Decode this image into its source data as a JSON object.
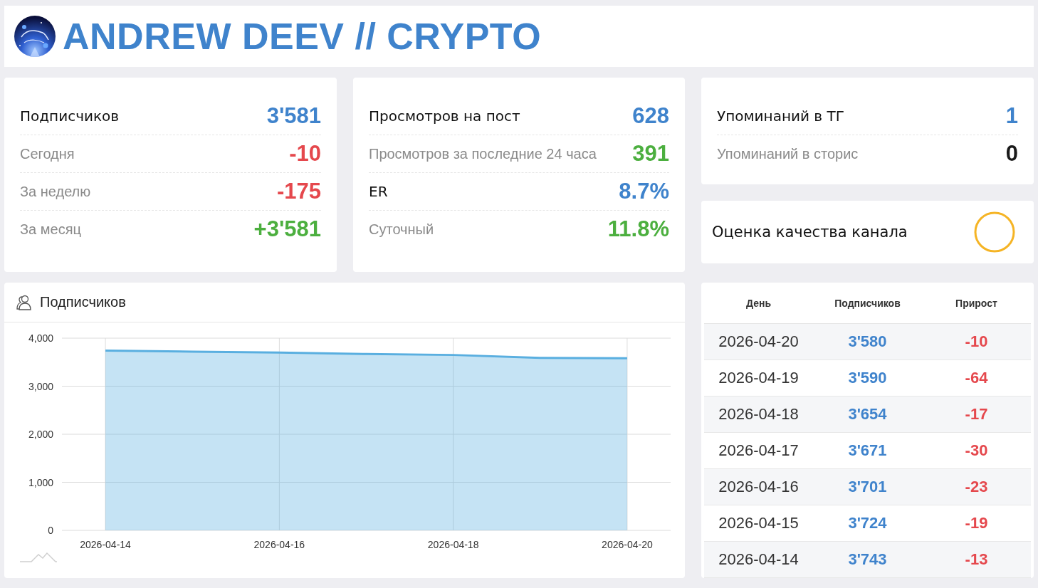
{
  "header": {
    "title": "ANDREW DEEV // CRYPTO"
  },
  "stat_cards": [
    {
      "rows": [
        {
          "kind": "heading",
          "label": "Подписчиков",
          "value": "3'581",
          "color": "#3f83cc"
        },
        {
          "kind": "detail",
          "label": "Сегодня",
          "value": "-10",
          "color": "#e5484d"
        },
        {
          "kind": "detail",
          "label": "За неделю",
          "value": "-175",
          "color": "#e5484d"
        },
        {
          "kind": "detail",
          "label": "За месяц",
          "value": "+3'581",
          "color": "#4caf3f"
        }
      ]
    },
    {
      "rows": [
        {
          "kind": "heading",
          "label": "Просмотров на пост",
          "value": "628",
          "color": "#3f83cc"
        },
        {
          "kind": "detail",
          "label": "Просмотров за последние 24 часа",
          "value": "391",
          "color": "#4caf3f"
        },
        {
          "kind": "heading",
          "label": "ER",
          "value": "8.7%",
          "color": "#3f83cc"
        },
        {
          "kind": "detail",
          "label": "Суточный",
          "value": "11.8%",
          "color": "#4caf3f"
        }
      ]
    }
  ],
  "mentions_card": {
    "rows": [
      {
        "kind": "heading",
        "label": "Упоминаний в ТГ",
        "value": "1",
        "color": "#3f83cc"
      },
      {
        "kind": "detail",
        "label": "Упоминаний в сторис",
        "value": "0",
        "color": "#1a1a1a"
      }
    ]
  },
  "quality_card": {
    "label": "Оценка качества канала"
  },
  "chart_panel": {
    "chart_data": {
      "type": "area",
      "title": "Подписчиков",
      "x": [
        "2026-04-14",
        "2026-04-15",
        "2026-04-16",
        "2026-04-17",
        "2026-04-18",
        "2026-04-19",
        "2026-04-20"
      ],
      "series": [
        {
          "color": "#5aafe0",
          "values": [
            3740,
            3720,
            3700,
            3670,
            3650,
            3590,
            3580
          ]
        }
      ],
      "xlim": [
        "2026-04-13 12:00",
        "2026-04-20 12:00"
      ],
      "grid": true,
      "ylim": [
        0,
        4000
      ],
      "yticks": [
        {
          "value": 0,
          "label": "0"
        },
        {
          "value": 1000,
          "label": "1,000"
        },
        {
          "value": 2000,
          "label": "2,000"
        },
        {
          "value": 3000,
          "label": "3,000"
        },
        {
          "value": 4000,
          "label": "4,000"
        }
      ],
      "xticks": [
        "2026-04-14",
        "2026-04-16",
        "2026-04-18",
        "2026-04-20"
      ]
    }
  },
  "table": {
    "columns": [
      "День",
      "Подписчиков",
      "Прирост"
    ],
    "rows": [
      [
        "2026-04-20",
        "3'580",
        "-10"
      ],
      [
        "2026-04-19",
        "3'590",
        "-64"
      ],
      [
        "2026-04-18",
        "3'654",
        "-17"
      ],
      [
        "2026-04-17",
        "3'671",
        "-30"
      ],
      [
        "2026-04-16",
        "3'701",
        "-23"
      ],
      [
        "2026-04-15",
        "3'724",
        "-19"
      ],
      [
        "2026-04-14",
        "3'743",
        "-13"
      ]
    ]
  }
}
